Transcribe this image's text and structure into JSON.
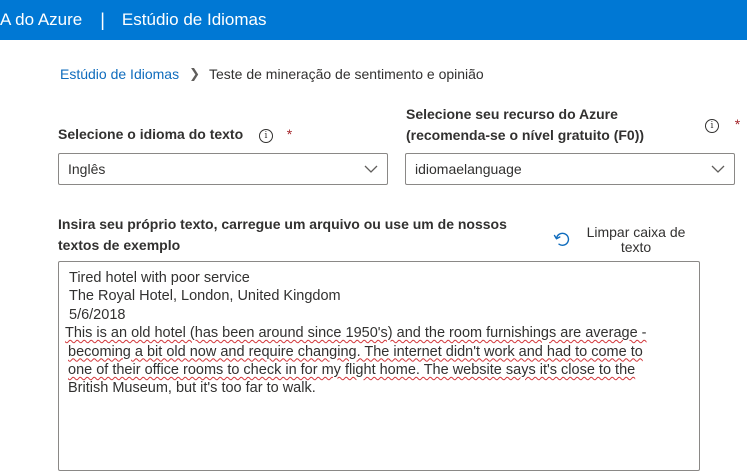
{
  "header": {
    "brand": "A do Azure",
    "separator": "|",
    "product": "Estúdio de Idiomas"
  },
  "breadcrumb": {
    "link": "Estúdio de Idiomas",
    "current": "Teste de mineração de sentimento e opinião"
  },
  "language": {
    "label": "Selecione o idioma do texto",
    "info_icon": "ⓘ",
    "required_mark": "*",
    "selected": "Inglês"
  },
  "resource": {
    "label_line1": "Selecione seu recurso do Azure",
    "label_line2": "(recomenda-se o nível gratuito (F0))",
    "info_icon": "ⓘ",
    "required_mark": "*",
    "selected": "idiomaelanguage"
  },
  "input_section": {
    "label_line1": "Insira seu próprio texto, carregue um arquivo ou use um de nossos",
    "label_line2": "textos de exemplo",
    "clear_label_line1": "Limpar caixa de",
    "clear_label_line2": "texto"
  },
  "text_input": {
    "line1": "Tired hotel with poor service",
    "line2": "The Royal Hotel, London, United Kingdom",
    "line3": "5/6/2018",
    "line4": " This is an old hotel (has been around since 1950's) and the room furnishings are average -",
    "line5": "becoming a bit old now and require changing. The internet didn't work and had to come to",
    "line6": "one of their office rooms to check in for my flight home. The website says it's close to the",
    "line7": "British Museum, but it's too far to walk."
  },
  "colors": {
    "header_bg": "#0078d4",
    "link": "#0f6cbd",
    "required": "#a4262c",
    "spellcheck": "#d13438"
  },
  "icons": {
    "dropdown": "chevron-down-icon",
    "info": "info-icon",
    "clear": "undo-icon"
  }
}
